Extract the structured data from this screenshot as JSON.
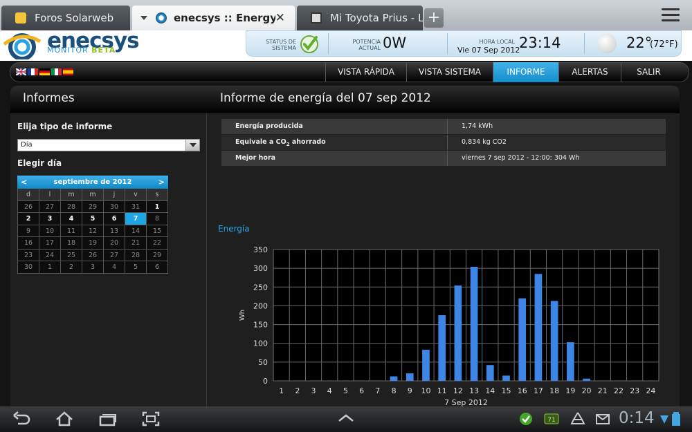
{
  "browser": {
    "tabs": [
      {
        "label": "Foros Solarweb",
        "active": false,
        "icon": "star-favicon"
      },
      {
        "label": "enecsys :: Energy ...",
        "active": true,
        "icon": "enecsys-favicon"
      },
      {
        "label": "Mi Toyota Prius - L...",
        "active": false,
        "icon": "page-favicon"
      }
    ],
    "new_tab": "+",
    "close": "✕"
  },
  "logo": {
    "title": "enecsys",
    "subtitle_a": "MONITOR",
    "subtitle_b": "BETA"
  },
  "status": {
    "status_label_1": "STATUS DE",
    "status_label_2": "SISTEMA",
    "power_label_1": "POTENCIA",
    "power_label_2": "ACTUAL",
    "power_value": "0W",
    "time_label": "HORA LOCAL",
    "date_value": "Vie 07 Sep 2012",
    "time_value": "23:14",
    "temp_c": "22°",
    "temp_f": "(72°F)",
    "colors": {
      "panel": "#d6ebf8",
      "ok": "#7cc043"
    }
  },
  "nav": {
    "items": [
      "VISTA RÁPIDA",
      "VISTA SISTEMA",
      "INFORME",
      "ALERTAS",
      "SALIR"
    ],
    "active": "INFORME",
    "flags": [
      "uk-flag",
      "fr-flag",
      "de-flag",
      "it-flag",
      "es-flag"
    ]
  },
  "panel": {
    "title": "Informes",
    "heading": "Informe de energía del 07 sep 2012",
    "choose_type_label": "Elija tipo de informe",
    "type_value": "Día",
    "choose_day_label": "Elegir día"
  },
  "calendar": {
    "month": "septiembre de 2012",
    "prev": "<",
    "next": ">",
    "weekdays": [
      "d",
      "l",
      "m",
      "m",
      "j",
      "v",
      "s"
    ],
    "rows": [
      [
        "26",
        "27",
        "28",
        "29",
        "30",
        "31",
        "1"
      ],
      [
        "2",
        "3",
        "4",
        "5",
        "6",
        "7",
        "8"
      ],
      [
        "9",
        "10",
        "11",
        "12",
        "13",
        "14",
        "15"
      ],
      [
        "16",
        "17",
        "18",
        "19",
        "20",
        "21",
        "22"
      ],
      [
        "23",
        "24",
        "25",
        "26",
        "27",
        "28",
        "29"
      ],
      [
        "30",
        "1",
        "2",
        "3",
        "4",
        "5",
        "6"
      ]
    ],
    "available": [
      "1",
      "2",
      "3",
      "4",
      "5",
      "6"
    ],
    "selected": "7"
  },
  "summary": [
    {
      "key": "Energía producida",
      "value": "1,74 kWh"
    },
    {
      "key": "Equivale a CO2 ahorrado",
      "value": "0,834 kg CO2"
    },
    {
      "key": "Mejor hora",
      "value": "viernes 7 sep 2012 - 12:00: 304 Wh"
    }
  ],
  "chart_data": {
    "type": "bar",
    "title": "Energía",
    "xlabel": "7 Sep 2012",
    "ylabel": "Wh",
    "ylim": [
      0,
      350
    ],
    "yticks": [
      0,
      50,
      100,
      150,
      200,
      250,
      300,
      350
    ],
    "categories": [
      "1",
      "2",
      "3",
      "4",
      "5",
      "6",
      "7",
      "8",
      "9",
      "10",
      "11",
      "12",
      "13",
      "14",
      "15",
      "16",
      "17",
      "18",
      "19",
      "20",
      "21",
      "22",
      "23",
      "24"
    ],
    "values": [
      0,
      0,
      0,
      0,
      0,
      0,
      0,
      12,
      20,
      83,
      175,
      254,
      304,
      42,
      14,
      220,
      285,
      213,
      103,
      6,
      0,
      0,
      0,
      0
    ],
    "grid": true,
    "bar_color": "#3d86e6"
  },
  "system": {
    "clock": "0:14",
    "notification_count": "71"
  }
}
